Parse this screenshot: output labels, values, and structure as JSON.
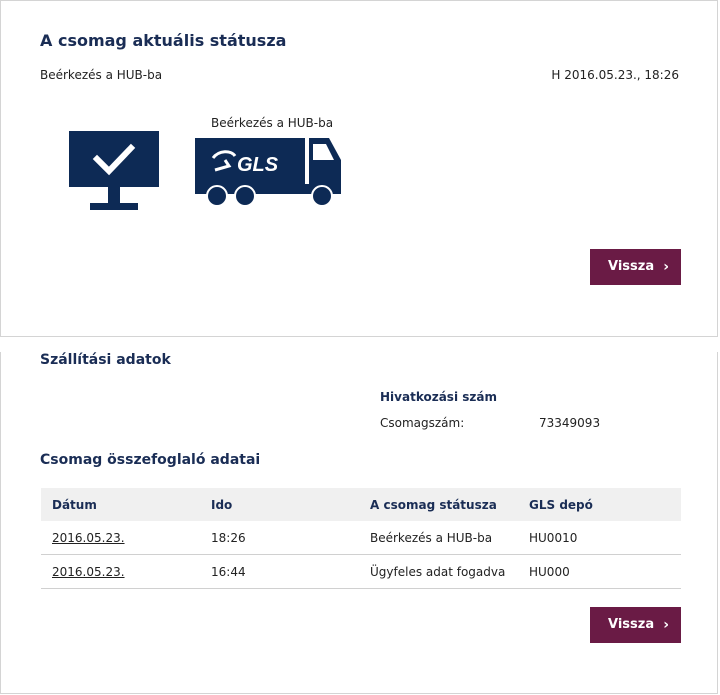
{
  "status_card": {
    "title": "A csomag aktuális státusza",
    "status_text": "Beérkezés a HUB-ba",
    "timestamp": "H 2016.05.23., 18:26",
    "truck_caption": "Beérkezés a HUB-ba",
    "truck_logo": "GLS",
    "back_button": "Vissza"
  },
  "details_card": {
    "shipping_title": "Szállítási adatok",
    "reference_title": "Hivatkozási szám",
    "parcel_label": "Csomagszám:",
    "parcel_number": "73349093",
    "summary_title": "Csomag összefoglaló adatai",
    "table": {
      "headers": [
        "Dátum",
        "Ido",
        "A csomag státusza",
        "GLS depó"
      ],
      "rows": [
        [
          "2016.05.23.",
          "18:26",
          "Beérkezés a HUB-ba",
          "HU0010"
        ],
        [
          "2016.05.23.",
          "16:44",
          "Ügyfeles adat fogadva",
          "HU000"
        ]
      ]
    },
    "back_button": "Vissza"
  },
  "colors": {
    "navy": "#0d2a55",
    "button": "#6a1b45"
  },
  "icons": [
    "monitor-check-icon",
    "gls-truck-icon",
    "chevron-right-icon"
  ]
}
